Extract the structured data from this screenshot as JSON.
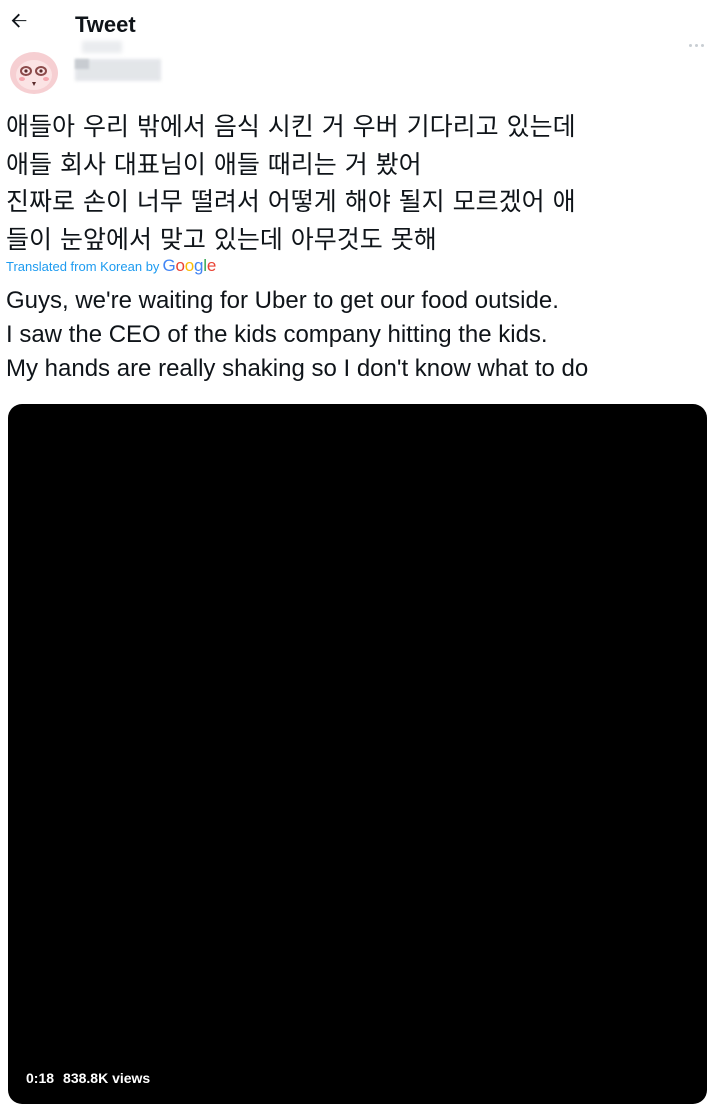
{
  "header": {
    "title": "Tweet",
    "back_icon": "arrow-left-icon"
  },
  "author": {
    "avatar_icon": "pink-cartoon-avatar",
    "avatar_color": "#f6cfd2"
  },
  "tweet": {
    "korean_text": "애들아 우리 밖에서 음식 시킨 거 우버 기다리고 있는데\n애들 회사 대표님이 애들 때리는 거 봤어\n진짜로 손이 너무 떨려서 어떻게 해야 될지 모르겠어 애\n들이 눈앞에서 맞고 있는데 아무것도 못해",
    "translated_label": "Translated from Korean by",
    "translator": [
      "G",
      "o",
      "o",
      "g",
      "l",
      "e"
    ],
    "english_text": "Guys, we're waiting for Uber to get our food outside.\nI saw the CEO of the kids company hitting the kids.\nMy hands are really shaking so I don't know what to do"
  },
  "video": {
    "duration": "0:18",
    "views": "838.8K views",
    "background": "#000000"
  },
  "colors": {
    "link": "#1d9bf0",
    "text": "#0f1419",
    "muted": "#c9ced3"
  }
}
